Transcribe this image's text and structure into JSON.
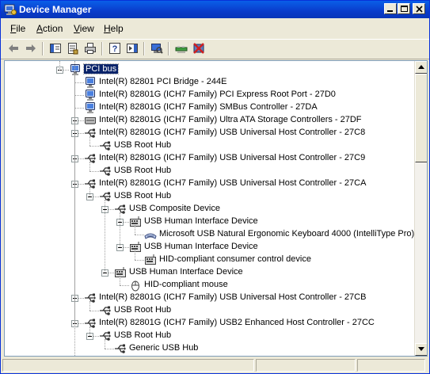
{
  "window": {
    "title": "Device Manager"
  },
  "menu": [
    {
      "label": "File",
      "accel": "F",
      "rest": "ile"
    },
    {
      "label": "Action",
      "accel": "A",
      "rest": "ction"
    },
    {
      "label": "View",
      "accel": "V",
      "rest": "iew"
    },
    {
      "label": "Help",
      "accel": "H",
      "rest": "elp"
    }
  ],
  "toolbar_icons": [
    "back-arrow-icon",
    "forward-arrow-icon",
    "show-hide-tree-icon",
    "properties-icon",
    "print-icon",
    "help-icon",
    "show-hide-action-pane-icon",
    "scan-hardware-icon",
    "update-driver-icon",
    "uninstall-icon"
  ],
  "tree": [
    {
      "label": "PCI bus",
      "level": 0,
      "icon": "monitor",
      "exp": "minus",
      "selected": true
    },
    {
      "label": "Intel(R) 82801 PCI Bridge - 244E",
      "level": 1,
      "icon": "monitor"
    },
    {
      "label": "Intel(R) 82801G (ICH7 Family) PCI Express Root Port - 27D0",
      "level": 1,
      "icon": "monitor"
    },
    {
      "label": "Intel(R) 82801G (ICH7 Family) SMBus Controller - 27DA",
      "level": 1,
      "icon": "monitor"
    },
    {
      "label": "Intel(R) 82801G (ICH7 Family) Ultra ATA Storage Controllers - 27DF",
      "level": 1,
      "icon": "ide",
      "exp": "plus"
    },
    {
      "label": "Intel(R) 82801G (ICH7 Family) USB Universal Host Controller - 27C8",
      "level": 1,
      "icon": "usb",
      "exp": "minus"
    },
    {
      "label": "USB Root Hub",
      "level": 2,
      "icon": "usb"
    },
    {
      "label": "Intel(R) 82801G (ICH7 Family) USB Universal Host Controller - 27C9",
      "level": 1,
      "icon": "usb",
      "exp": "minus"
    },
    {
      "label": "USB Root Hub",
      "level": 2,
      "icon": "usb"
    },
    {
      "label": "Intel(R) 82801G (ICH7 Family) USB Universal Host Controller - 27CA",
      "level": 1,
      "icon": "usb",
      "exp": "minus"
    },
    {
      "label": "USB Root Hub",
      "level": 2,
      "icon": "usb",
      "exp": "minus"
    },
    {
      "label": "USB Composite Device",
      "level": 3,
      "icon": "usb",
      "exp": "minus"
    },
    {
      "label": "USB Human Interface Device",
      "level": 4,
      "icon": "hid",
      "exp": "minus"
    },
    {
      "label": "Microsoft USB Natural Ergonomic Keyboard 4000 (IntelliType Pro)",
      "level": 5,
      "icon": "keyboard"
    },
    {
      "label": "USB Human Interface Device",
      "level": 4,
      "icon": "hid",
      "exp": "minus"
    },
    {
      "label": "HID-compliant consumer control device",
      "level": 5,
      "icon": "hid"
    },
    {
      "label": "USB Human Interface Device",
      "level": 3,
      "icon": "hid",
      "exp": "minus"
    },
    {
      "label": "HID-compliant mouse",
      "level": 4,
      "icon": "mouse"
    },
    {
      "label": "Intel(R) 82801G (ICH7 Family) USB Universal Host Controller - 27CB",
      "level": 1,
      "icon": "usb",
      "exp": "minus"
    },
    {
      "label": "USB Root Hub",
      "level": 2,
      "icon": "usb"
    },
    {
      "label": "Intel(R) 82801G (ICH7 Family) USB2 Enhanced Host Controller - 27CC",
      "level": 1,
      "icon": "usb",
      "exp": "minus"
    },
    {
      "label": "USB Root Hub",
      "level": 2,
      "icon": "usb",
      "exp": "minus"
    },
    {
      "label": "Generic USB Hub",
      "level": 3,
      "icon": "usb"
    }
  ]
}
